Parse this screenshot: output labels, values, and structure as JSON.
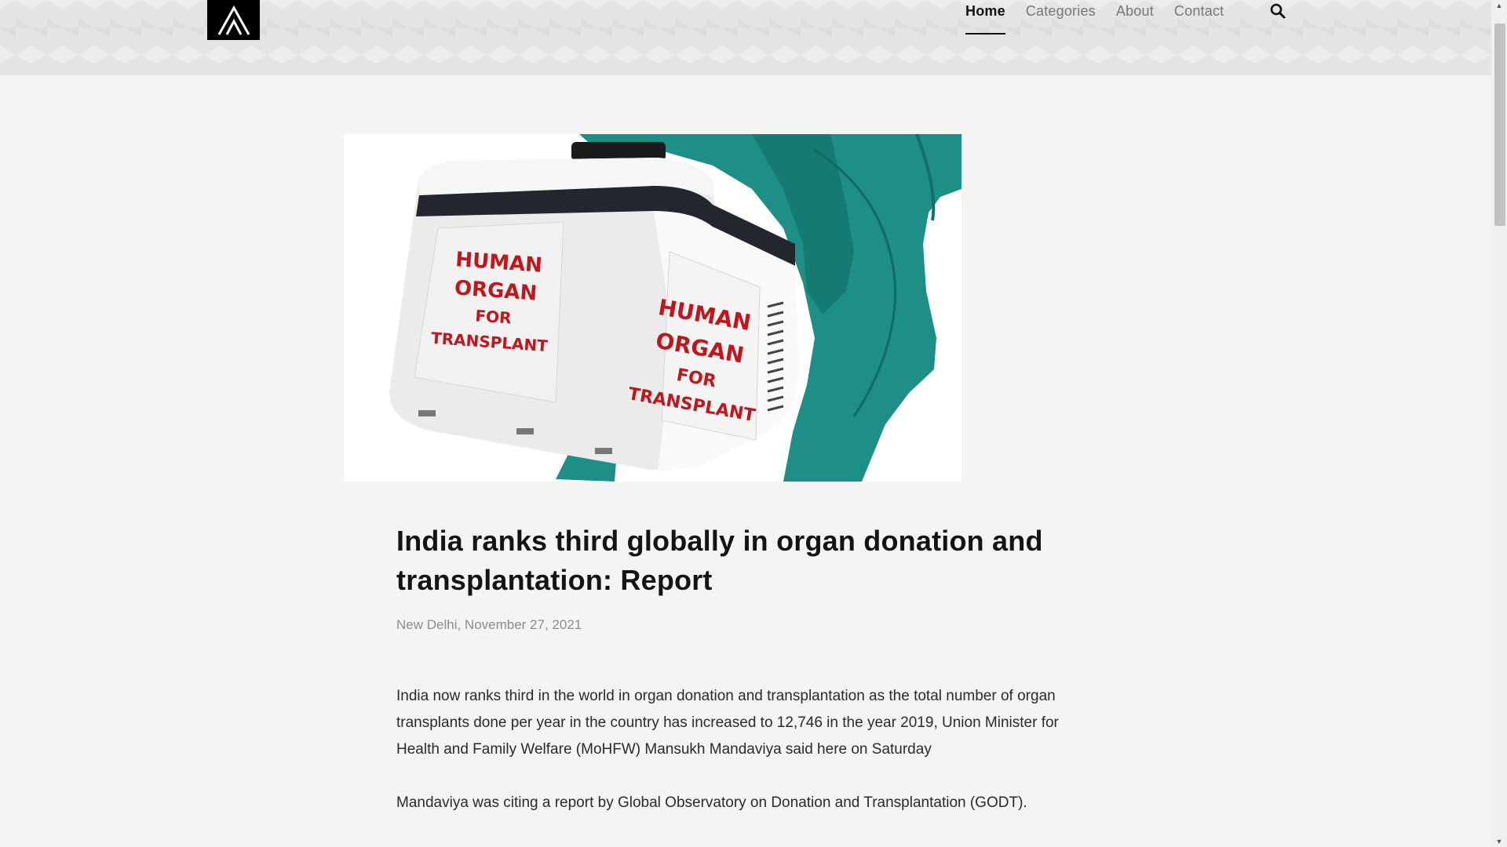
{
  "nav": {
    "items": [
      {
        "label": "Home",
        "active": true
      },
      {
        "label": "Categories",
        "active": false
      },
      {
        "label": "About",
        "active": false
      },
      {
        "label": "Contact",
        "active": false
      }
    ]
  },
  "hero": {
    "box_label_left": [
      "HUMAN",
      "ORGAN",
      "FOR",
      "TRANSPLANT"
    ],
    "box_label_right": [
      "HUMAN",
      "ORGAN",
      "FOR",
      "TRANSPLANT"
    ]
  },
  "article": {
    "title": "India ranks third globally in organ donation and transplantation: Report",
    "meta": "New Delhi, November 27, 2021",
    "paragraphs": [
      "India now ranks third in the world in organ donation and transplantation as the total number of organ transplants done per year in the country has increased to 12,746 in the year 2019, Union Minister for Health and Family Welfare (MoHFW) Mansukh Mandaviya said here on Saturday",
      "Mandaviya was citing a report by Global Observatory on Donation and Transplantation (GODT)."
    ]
  },
  "colors": {
    "text": "#141414",
    "muted": "#8c8c8c",
    "scrubs": "#1d8f86",
    "label_red": "#c0161c"
  }
}
